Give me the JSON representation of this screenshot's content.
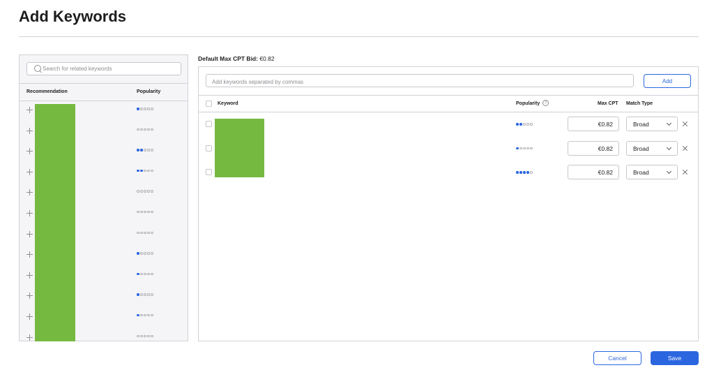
{
  "page": {
    "title": "Add Keywords"
  },
  "left_panel": {
    "search_placeholder": "Search for related keywords",
    "col_recommendation": "Recommendation",
    "col_popularity": "Popularity",
    "rows": [
      {
        "popularity": 1
      },
      {
        "popularity": 0
      },
      {
        "popularity": 2
      },
      {
        "popularity": 2
      },
      {
        "popularity": 0
      },
      {
        "popularity": 0
      },
      {
        "popularity": 0
      },
      {
        "popularity": 1
      },
      {
        "popularity": 1
      },
      {
        "popularity": 1
      },
      {
        "popularity": 1
      },
      {
        "popularity": 0
      }
    ]
  },
  "right_panel": {
    "default_bid_label": "Default Max CPT Bid:",
    "default_bid_value": "€0.82",
    "keyword_input_placeholder": "Add keywords separated by commas",
    "add_button": "Add",
    "col_keyword": "Keyword",
    "col_popularity": "Popularity",
    "help_icon_glyph": "?",
    "col_max_cpt": "Max CPT",
    "col_match_type": "Match Type",
    "rows": [
      {
        "popularity": 2,
        "max_cpt": "€0.82",
        "match_type": "Broad"
      },
      {
        "popularity": 1,
        "max_cpt": "€0.82",
        "match_type": "Broad"
      },
      {
        "popularity": 4,
        "max_cpt": "€0.82",
        "match_type": "Broad"
      }
    ]
  },
  "footer": {
    "cancel": "Cancel",
    "save": "Save"
  },
  "colors": {
    "accent": "#2b66e0",
    "redaction": "#76b941"
  }
}
